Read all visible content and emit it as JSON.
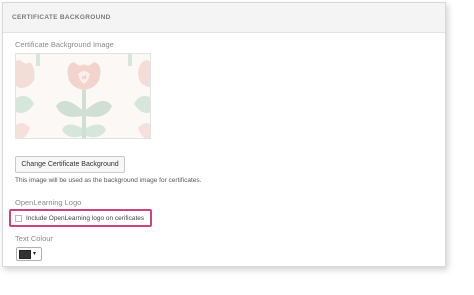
{
  "section": {
    "title": "CERTIFICATE BACKGROUND"
  },
  "background": {
    "label": "Certificate Background Image",
    "change_button": "Change Certificate Background",
    "help_text": "This image will be used as the background image for certificates."
  },
  "logo": {
    "label": "OpenLearning Logo",
    "checkbox_label": "Include OpenLearning logo on cerificates",
    "checked": false
  },
  "text_colour": {
    "label": "Text Colour",
    "value": "#333333",
    "caret": "▾"
  },
  "colors": {
    "highlight": "#c9457c",
    "pattern_red": "#e9b4ac",
    "pattern_green": "#cfe0d3"
  }
}
